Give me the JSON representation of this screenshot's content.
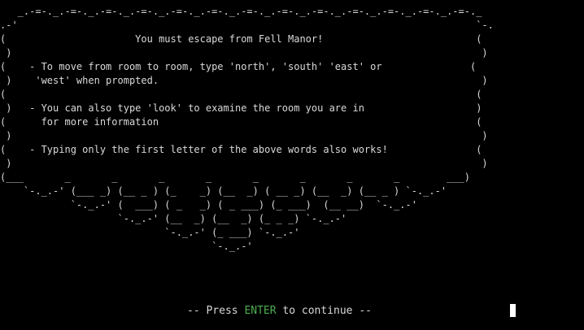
{
  "screen": {
    "lines": [
      "   _.-=-._.-=-._.-=-._.-=-._.-=-._.-=-._.-=-._.-=-._.-=-._.-=-._.-=-._.-=-._.-=-._",
      ".-'                                                                              `-.",
      "(                      You must escape from Fell Manor!                          (",
      " )                                                                                )",
      "(    - To move from room to room, type 'north', 'south' 'east' or               (",
      " )    'west' when prompted.                                                       )",
      "(                                                                                (",
      " )   - You can also type 'look' to examine the room you are in                   )",
      "(      for more information                                                      (",
      " )                                                                                )",
      "(    - Typing only the first letter of the above words also works!               (",
      " )                                                                                )",
      "(___       _       _       _       _       _       _       _       _        ___)",
      "    `-._.-' (___ _) (__ _ ) (_    _) (__  _) ( __ _) (__  _) (__ _ ) `-._.-'",
      "            `-._.-' (  ___) ( _   _) ( _ ___) (_ ___)  (__ __)  `-._.-'",
      "                    `-._.-' (__  _) (__  _) (_ _ _) `-._.-'",
      "                            `-._.-' (_ ___) `-._.-'",
      "                                    `-._.-'"
    ]
  },
  "prompt": {
    "prefix": "-- Press ",
    "key": "ENTER",
    "suffix": " to continue --"
  },
  "colors": {
    "background": "#000000",
    "text": "#d9d9d9",
    "accent_key": "#4caf50",
    "cursor": "#ffffff"
  }
}
